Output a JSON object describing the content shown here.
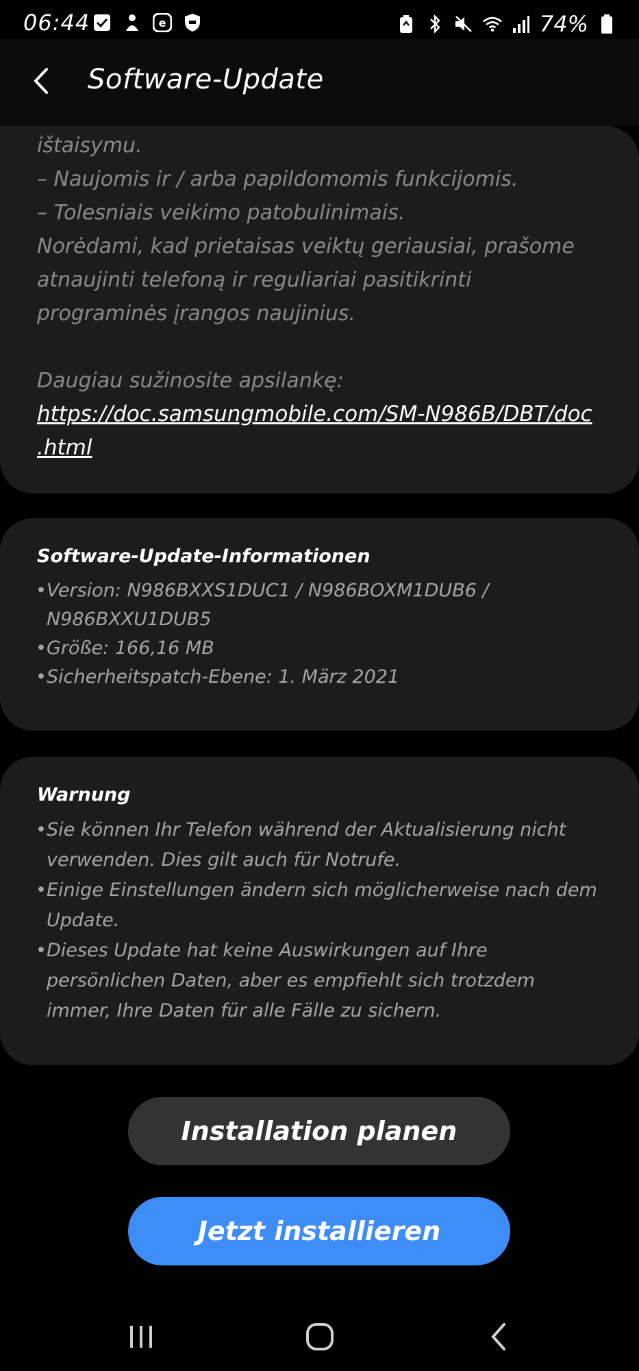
{
  "status_bar": {
    "time": "06:44",
    "battery": "74%",
    "left_icons": [
      "checkbox-notification-icon",
      "cleaner-icon",
      "e-app-icon",
      "shield-icon"
    ],
    "right_icons": [
      "battery-saver-icon",
      "bluetooth-icon",
      "mute-icon",
      "wifi-icon",
      "signal-icon",
      "battery-icon"
    ]
  },
  "header": {
    "title": "Software-Update"
  },
  "release_notes": {
    "lines": [
      "ištaisymu.",
      " – Naujomis ir / arba papildomomis funkcijomis.",
      " – Tolesniais veikimo patobulinimais.",
      "Norėdami, kad prietaisas veiktų geriausiai, prašome",
      "atnaujinti telefoną ir reguliariai pasitikrinti",
      "programinės įrangos naujinius."
    ],
    "more_info": "Daugiau sužinosite apsilankę:",
    "link_line1": "https://doc.samsungmobile.com/SM-N986B/DBT/doc",
    "link_line2": ".html"
  },
  "update_info": {
    "heading": "Software-Update-Informationen",
    "version": "Version: N986BXXS1DUC1 / N986BOXM1DUB6 / N986BXXU1DUB5",
    "size": "Größe: 166,16 MB",
    "security_patch": "Sicherheitspatch-Ebene: 1. März 2021"
  },
  "warning": {
    "heading": "Warnung",
    "items": [
      "Sie können Ihr Telefon während der Aktualisierung nicht verwenden. Dies gilt auch für Notrufe.",
      "Einige Einstellungen ändern sich möglicherweise nach dem Update.",
      "Dieses Update hat keine Auswirkungen auf Ihre persönlichen Daten, aber es empfiehlt sich trotzdem immer, Ihre Daten für alle Fälle zu sichern."
    ]
  },
  "buttons": {
    "schedule": "Installation planen",
    "install": "Jetzt installieren"
  },
  "colors": {
    "accent": "#3e8cf5",
    "card": "#1c1c1c",
    "background": "#000000"
  }
}
